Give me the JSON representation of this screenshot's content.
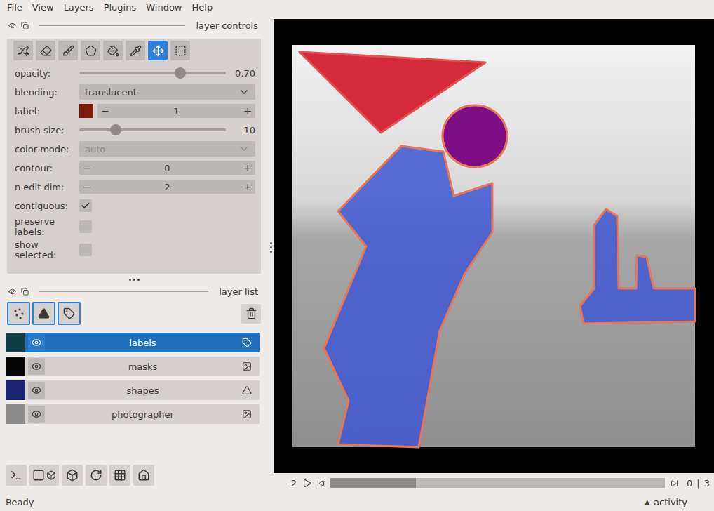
{
  "menu": [
    "File",
    "View",
    "Layers",
    "Plugins",
    "Window",
    "Help"
  ],
  "layer_controls": {
    "title": "layer controls",
    "tools": [
      {
        "kind": "shuffle",
        "selected": false
      },
      {
        "kind": "erase",
        "selected": false
      },
      {
        "kind": "paint",
        "selected": false
      },
      {
        "kind": "polygon",
        "selected": false
      },
      {
        "kind": "fill",
        "selected": false
      },
      {
        "kind": "pick",
        "selected": false
      },
      {
        "kind": "pan_zoom",
        "selected": true
      },
      {
        "kind": "transform",
        "selected": false
      }
    ],
    "rows": [
      {
        "kind": "slider",
        "label": "opacity:",
        "level": 0.69,
        "reading": "0.70"
      },
      {
        "kind": "dropdown",
        "label": "blending:",
        "value": "translucent",
        "disabled": false
      },
      {
        "kind": "label",
        "label": "label:",
        "value": "1",
        "color": "#7a1d0c",
        "minus": "−",
        "plus": "+"
      },
      {
        "kind": "slider",
        "label": "brush size:",
        "level": 0.25,
        "reading": "10"
      },
      {
        "kind": "dropdown",
        "label": "color mode:",
        "value": "auto",
        "disabled": true
      },
      {
        "kind": "spin",
        "label": "contour:",
        "value": "0",
        "minus": "−",
        "plus": "+"
      },
      {
        "kind": "spin",
        "label": "n edit dim:",
        "value": "2",
        "minus": "−",
        "plus": "+"
      },
      {
        "kind": "checkbox",
        "label": "contiguous:",
        "checked": true
      },
      {
        "kind": "checkbox",
        "label": "preserve labels:",
        "checked": false
      },
      {
        "kind": "checkbox",
        "label": "show selected:",
        "checked": false
      }
    ]
  },
  "layer_list": {
    "title": "layer list",
    "new_layer_buttons": [
      {
        "kind": "points"
      },
      {
        "kind": "shapes"
      },
      {
        "kind": "labels"
      }
    ],
    "layers": [
      {
        "name": "labels",
        "kind": "labels",
        "selected": true,
        "visible": true,
        "color": "#123c46"
      },
      {
        "name": "masks",
        "kind": "image",
        "selected": false,
        "visible": true,
        "color": "#050505"
      },
      {
        "name": "shapes",
        "kind": "shapes",
        "selected": false,
        "visible": true,
        "color": "#1c2370"
      },
      {
        "name": "photographer",
        "kind": "image",
        "selected": false,
        "visible": true,
        "color": "#8c8c8c"
      }
    ]
  },
  "viewer_buttons": [
    {
      "kind": "console"
    },
    {
      "kind": "ndisplay"
    },
    {
      "kind": "roll"
    },
    {
      "kind": "transpose"
    },
    {
      "kind": "grid"
    },
    {
      "kind": "home"
    }
  ],
  "canvas": {
    "shapes": [
      {
        "kind": "triangle",
        "color": "#d42a3b",
        "edge_color": "#e0524f"
      },
      {
        "kind": "ellipse",
        "color": "#7f0d86",
        "edge_color": "#e8745a"
      },
      {
        "kind": "person",
        "color": "#3f57d2",
        "edge_color": "#e8745a"
      },
      {
        "kind": "ell",
        "color": "#3f57d2",
        "edge_color": "#e8745a"
      }
    ]
  },
  "dims": {
    "axis": "-2",
    "level": 0,
    "value": "0",
    "separator": "|",
    "max": "3"
  },
  "status_bar": {
    "message": "Ready",
    "activity_icon": "▲",
    "activity": "activity"
  }
}
